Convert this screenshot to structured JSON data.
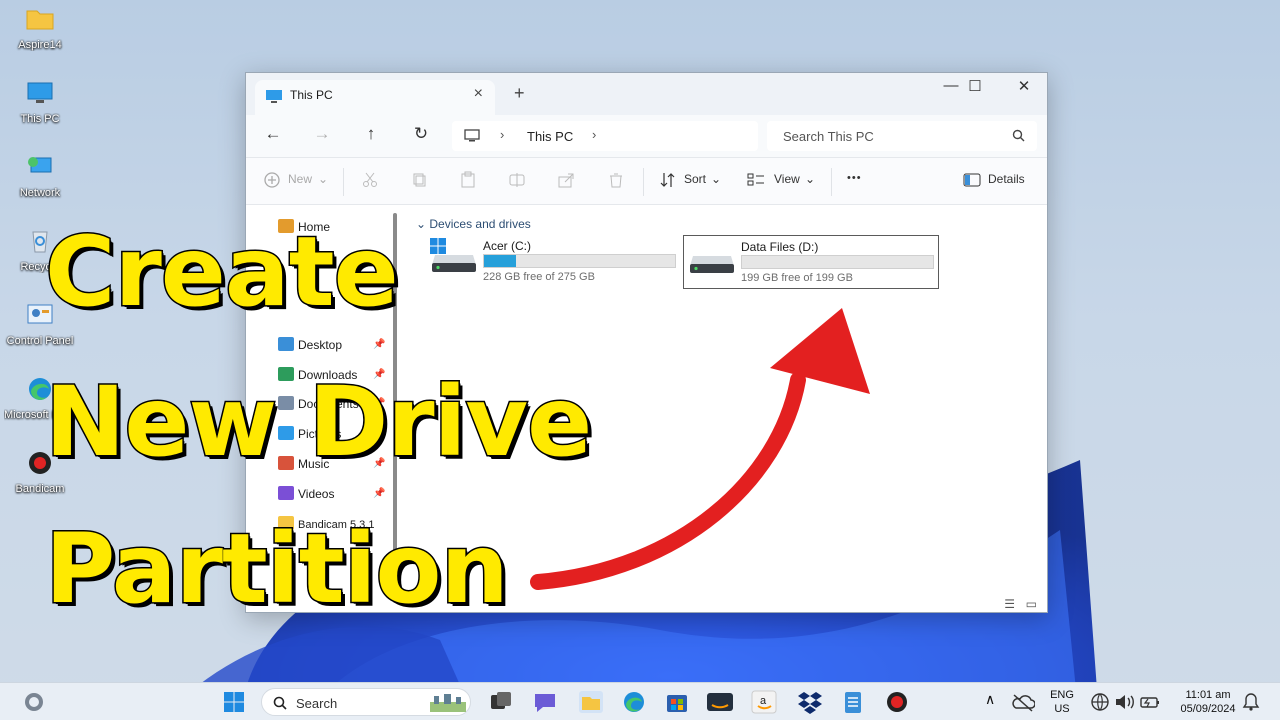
{
  "desktop": {
    "icons": [
      {
        "label": "Aspire14",
        "icon": "folder-icon"
      },
      {
        "label": "This PC",
        "icon": "monitor-icon"
      },
      {
        "label": "Network",
        "icon": "network-icon"
      },
      {
        "label": "Recycle",
        "icon": "recycle-bin-icon"
      },
      {
        "label": "Control Panel",
        "icon": "control-panel-icon"
      },
      {
        "label": "Microsoft Edge",
        "icon": "edge-icon"
      },
      {
        "label": "Bandicam",
        "icon": "bandicam-icon"
      }
    ]
  },
  "window": {
    "tab_title": "This PC",
    "new_tab": "+",
    "controls": {
      "minimize": "—",
      "maximize": "☐",
      "close": "✕"
    },
    "address": {
      "crumb": "This PC"
    },
    "search_placeholder": "Search This PC",
    "toolbar": {
      "new_label": "New",
      "sort_label": "Sort",
      "view_label": "View",
      "more_label": "•••",
      "details_label": "Details"
    },
    "nav_items": [
      {
        "label": "Home",
        "pinned": false
      },
      {
        "label": "Desktop",
        "pinned": true
      },
      {
        "label": "Downloads",
        "pinned": true
      },
      {
        "label": "Documents",
        "pinned": true
      },
      {
        "label": "Pictures",
        "pinned": true
      },
      {
        "label": "Music",
        "pinned": true
      },
      {
        "label": "Videos",
        "pinned": true
      },
      {
        "label": "Bandicam 5.3.1",
        "pinned": false
      }
    ],
    "group_header": "Devices and drives",
    "drives": [
      {
        "name": "Acer (C:)",
        "free": "228 GB free of 275 GB",
        "used_fraction": 0.17,
        "selected": false
      },
      {
        "name": "Data Files (D:)",
        "free": "199 GB free of 199 GB",
        "used_fraction": 0.0,
        "selected": true
      }
    ]
  },
  "overlay": {
    "line1": "Create",
    "line2": "New Drive",
    "line3": "Partition",
    "color": "#ffea00",
    "arrow_color": "#e32020"
  },
  "taskbar": {
    "search_placeholder": "Search",
    "language": {
      "line1": "ENG",
      "line2": "US"
    },
    "clock": {
      "time": "11:01 am",
      "date": "05/09/2024"
    }
  }
}
